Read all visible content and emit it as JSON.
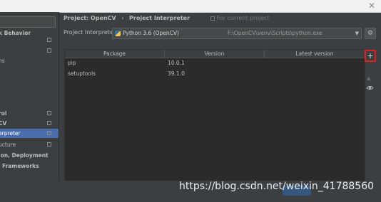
{
  "window": {
    "close_glyph": "✕"
  },
  "sidebar": {
    "items": [
      {
        "label": "k Behavior",
        "bold": true,
        "icon": false
      },
      {
        "label": "",
        "bold": false,
        "icon": true
      },
      {
        "label": "",
        "bold": false,
        "icon": true
      },
      {
        "label": "ns",
        "bold": false,
        "icon": false
      },
      {
        "label": "rol",
        "bold": true,
        "icon": true
      },
      {
        "label": "CV",
        "bold": true,
        "icon": true
      },
      {
        "label": "erpreter",
        "bold": false,
        "icon": true,
        "selected": true
      },
      {
        "label": "ucture",
        "bold": false,
        "icon": true
      },
      {
        "label": "ion, Deployment",
        "bold": true,
        "icon": false
      },
      {
        "label": "Frameworks",
        "bold": true,
        "icon": false
      }
    ]
  },
  "breadcrumb": {
    "project": "Project: OpenCV",
    "separator": "›",
    "page": "Project Interpreter",
    "note": "For current project"
  },
  "interpreter": {
    "label": "Project Interpreter:",
    "name": "Python 3.6 (OpenCV)",
    "path": "F:\\OpenCV\\venv\\Scripts\\python.exe",
    "dropdown_glyph": "▼",
    "gear_glyph": "⚙"
  },
  "table": {
    "columns": [
      "Package",
      "Version",
      "Latest version"
    ],
    "rows": [
      {
        "package": "pip",
        "version": "10.0.1",
        "latest": ""
      },
      {
        "package": "setuptools",
        "version": "39.1.0",
        "latest": ""
      }
    ]
  },
  "tools": {
    "add": "+",
    "remove": "▲"
  },
  "watermark": "https://blog.csdn.net/weixin_41788560",
  "colors": {
    "selection": "#4b6eaf",
    "highlight_box": "#e02020",
    "background": "#3c3f41"
  }
}
